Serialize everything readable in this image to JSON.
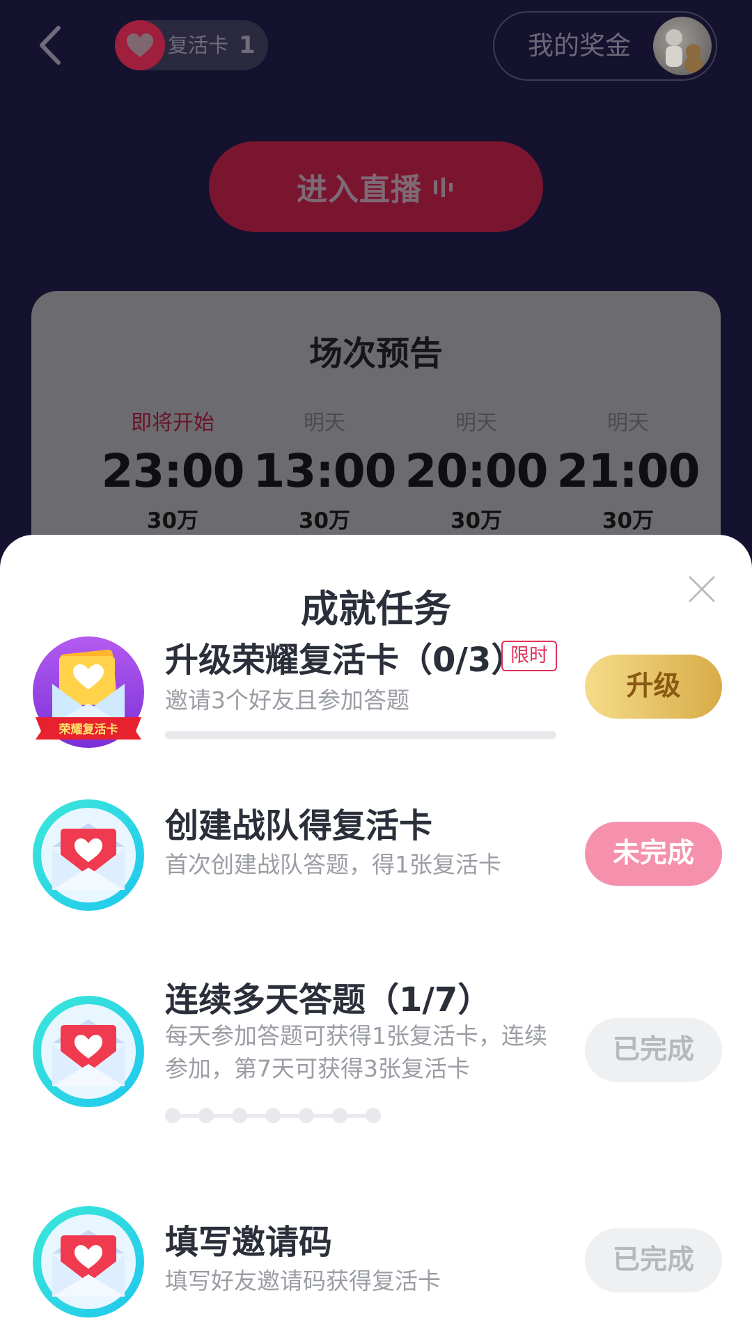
{
  "header": {
    "revive_card_label": "复活卡",
    "revive_card_count": "1",
    "my_bonus_label": "我的奖金"
  },
  "live_button_label": "进入直播",
  "schedule": {
    "title": "场次预告",
    "sessions": [
      {
        "when": "即将开始",
        "time": "23:00",
        "prize": "30万",
        "upcoming": true
      },
      {
        "when": "明天",
        "time": "13:00",
        "prize": "30万",
        "upcoming": false
      },
      {
        "when": "明天",
        "time": "20:00",
        "prize": "30万",
        "upcoming": false
      },
      {
        "when": "明天",
        "time": "21:00",
        "prize": "30万",
        "upcoming": false
      }
    ]
  },
  "sheet": {
    "title": "成就任务",
    "tasks": [
      {
        "title": "升级荣耀复活卡（0/3）",
        "tag": "限时",
        "desc": "邀请3个好友且参加答题",
        "icon_label": "荣耀复活卡",
        "progress": 0,
        "button": "升级",
        "icon": "honor-revive-card-icon"
      },
      {
        "title": "创建战队得复活卡",
        "desc": "首次创建战队答题，得1张复活卡",
        "button": "未完成",
        "icon": "envelope-heart-icon"
      },
      {
        "title": "连续多天答题（1/7）",
        "desc": "每天参加答题可获得1张复活卡，连续参加，第7天可获得3张复活卡",
        "days_total": 7,
        "days_done": 1,
        "button": "已完成",
        "icon": "envelope-heart-icon"
      },
      {
        "title": "填写邀请码",
        "desc": "填写好友邀请码获得复活卡",
        "button": "已完成",
        "icon": "envelope-heart-icon"
      }
    ]
  },
  "colors": {
    "background": "#15122f",
    "accent_red": "#e2304f",
    "gold": "#d8ac48",
    "pink": "#f590ad"
  }
}
